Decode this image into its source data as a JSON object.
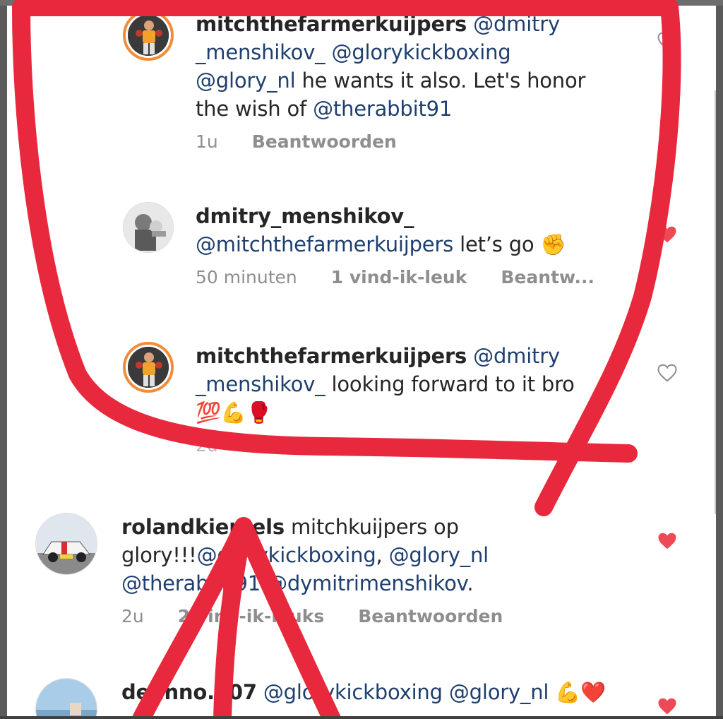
{
  "comments": [
    {
      "username": "mitchthefarmerkuijpers",
      "parts": [
        "@dmitry",
        "_menshikov_",
        "@glorykickboxing",
        "@glory_nl",
        " he wants it also. Let's honor",
        "the wish of ",
        "@therabbit91"
      ],
      "time": "1u",
      "reply": "Beantwoorden",
      "liked": false,
      "avatar_icon": "fighter-avatar-icon"
    },
    {
      "username": "dmitry_menshikov_",
      "parts": [
        "@mitchthefarmerkuijpers",
        " let’s go ✊"
      ],
      "time": "50 minuten",
      "likes": "1 vind-ik-leuk",
      "reply": "Beantw...",
      "liked": true,
      "avatar_icon": "boxer-avatar-icon"
    },
    {
      "username": "mitchthefarmerkuijpers",
      "parts": [
        "@dmitry",
        "_menshikov_",
        " looking forward to it bro",
        "💯💪🥊"
      ],
      "time": "2u",
      "reply": "Beantwoorden",
      "liked": false,
      "avatar_icon": "fighter-avatar-icon"
    },
    {
      "username": "rolandkierkels",
      "parts": [
        " mitchkuijpers op",
        "glory!!!",
        "@glorykickboxing",
        ", ",
        "@glory_nl",
        "@therabbit91",
        " ",
        "@dymitrimenshikov",
        "."
      ],
      "time": "2u",
      "likes": "2 vind-ik-leuks",
      "reply": "Beantwoorden",
      "liked": true,
      "avatar_icon": "car-avatar-icon"
    },
    {
      "username": "dennno.007",
      "parts": [
        " @glorykickboxing",
        " ",
        "@glory_nl",
        " 💪❤️"
      ],
      "liked": true,
      "avatar_icon": "landscape-avatar-icon"
    }
  ],
  "colors": {
    "text": "#262626",
    "mention": "#1f3f6e",
    "meta": "#8e8e8e",
    "heart_liked": "#ed4956",
    "annotation_red": "#e8283c"
  },
  "icons": [
    "heart-icon",
    "heart-outline-icon",
    "annotation-circle",
    "annotation-arrow"
  ]
}
